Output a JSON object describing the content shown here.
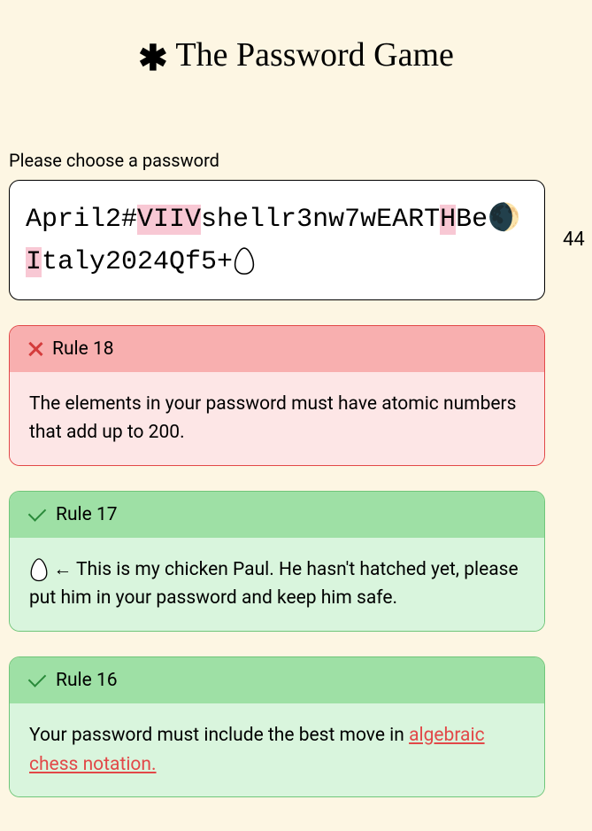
{
  "title": "The Password Game",
  "prompt": "Please choose a password",
  "password_segments": [
    {
      "text": "April2#",
      "hl": false
    },
    {
      "text": "VIIV",
      "hl": true
    },
    {
      "text": "shellr3nw7wEART",
      "hl": false
    },
    {
      "text": "H",
      "hl": true
    },
    {
      "text": "Be",
      "hl": false
    },
    {
      "text": "🌒",
      "hl": false,
      "emoji": true
    },
    {
      "text": "I",
      "hl": true
    },
    {
      "text": "taly2024Qf5+",
      "hl": false
    },
    {
      "text": "🥚",
      "hl": false,
      "egg": true
    }
  ],
  "char_count": 44,
  "rules": [
    {
      "num": 18,
      "pass": false,
      "header": "Rule 18",
      "body_plain": "The elements in your password must have atomic numbers that add up to 200."
    },
    {
      "num": 17,
      "pass": true,
      "header": "Rule 17",
      "body_html": "🥚 ← This is my chicken Paul. He hasn't hatched yet, please put him in your password and keep him safe.",
      "has_egg": true
    },
    {
      "num": 16,
      "pass": true,
      "header": "Rule 16",
      "body_pre": "Your password must include the best move in ",
      "link_text": "algebraic chess notation.",
      "link_href": "#"
    }
  ]
}
